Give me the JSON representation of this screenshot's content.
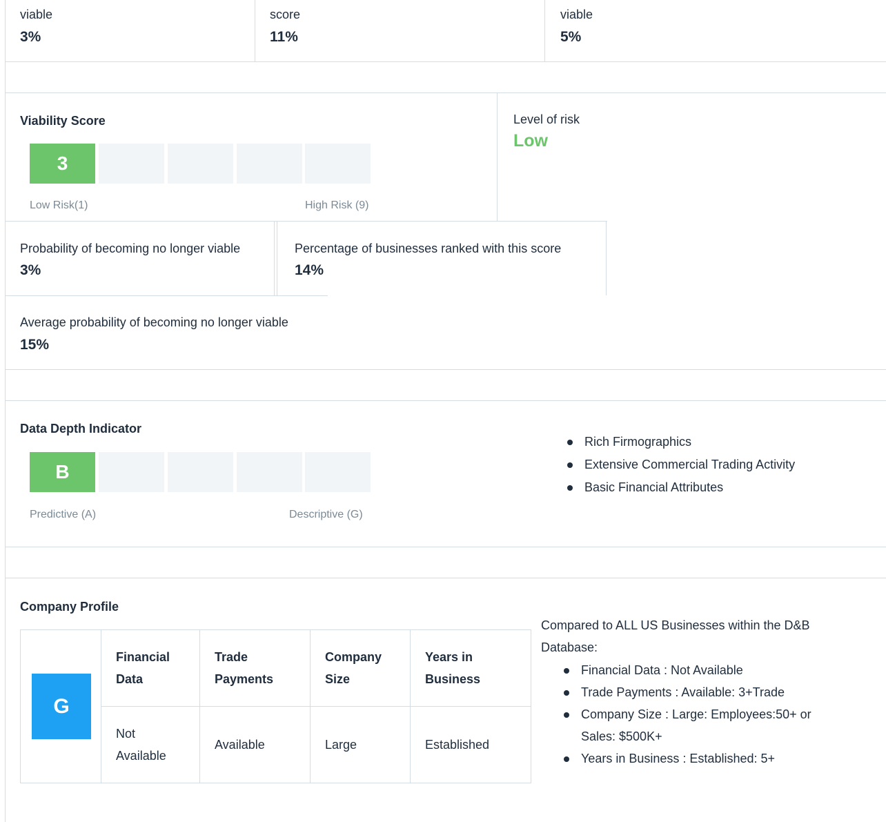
{
  "top_row": [
    {
      "label": "viable",
      "value": "3%"
    },
    {
      "label": "score",
      "value": "11%"
    },
    {
      "label": "viable",
      "value": "5%"
    }
  ],
  "viability": {
    "title": "Viability Score",
    "score": "3",
    "low_label": "Low Risk(1)",
    "high_label": "High Risk (9)",
    "risk_label": "Level of risk",
    "risk_value": "Low",
    "risk_color": "#6cc56b",
    "stats": [
      {
        "label": "Probability of becoming no longer viable",
        "value": "3%"
      },
      {
        "label": "Percentage of businesses ranked with this score",
        "value": "14%"
      },
      {
        "label": "Average probability of becoming no longer viable",
        "value": "15%"
      }
    ]
  },
  "data_depth": {
    "title": "Data Depth Indicator",
    "grade": "B",
    "low_label": "Predictive (A)",
    "high_label": "Descriptive (G)",
    "items": [
      "Rich Firmographics",
      "Extensive Commercial Trading Activity",
      "Basic Financial Attributes"
    ]
  },
  "company_profile": {
    "title": "Company Profile",
    "badge": "G",
    "badge_color": "#1ea1f2",
    "columns": [
      {
        "header_1": "Financial",
        "header_2": "Data",
        "value_1": "Not",
        "value_2": "Available"
      },
      {
        "header_1": "Trade",
        "header_2": "Payments",
        "value_1": "Available",
        "value_2": ""
      },
      {
        "header_1": "Company",
        "header_2": "Size",
        "value_1": "Large",
        "value_2": ""
      },
      {
        "header_1": "Years in",
        "header_2": "Business",
        "value_1": "Established",
        "value_2": ""
      }
    ],
    "compare_line_1": "Compared to ALL US Businesses within the D&B",
    "compare_line_2": "Database:",
    "details": [
      {
        "line_1": "Financial Data : Not Available",
        "line_2": ""
      },
      {
        "line_1": "Trade Payments : Available: 3+Trade",
        "line_2": ""
      },
      {
        "line_1": "Company Size : Large: Employees:50+ or",
        "line_2": "Sales: $500K+"
      },
      {
        "line_1": "Years in Business : Established: 5+",
        "line_2": ""
      }
    ]
  }
}
